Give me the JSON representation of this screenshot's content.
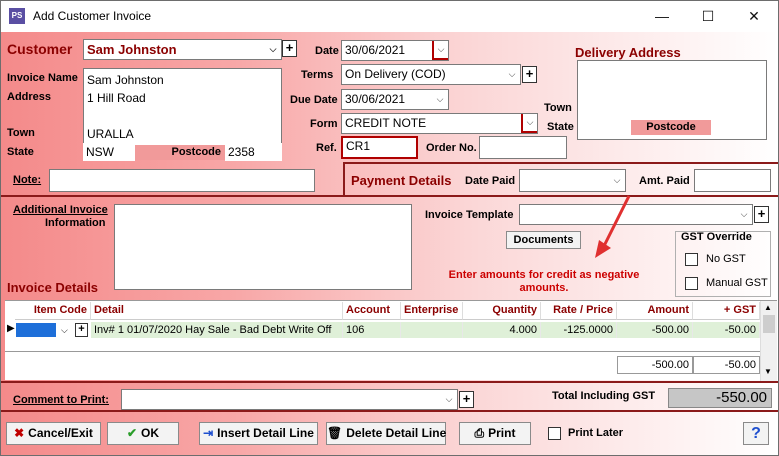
{
  "window": {
    "title": "Add Customer Invoice",
    "app_icon_text": "PS"
  },
  "customer": {
    "label": "Customer",
    "value": "Sam Johnston",
    "invoice_name_label": "Invoice Name",
    "address_label": "Address",
    "address_lines": [
      "Sam Johnston",
      "1 Hill Road",
      "",
      "URALLA"
    ],
    "town_label": "Town",
    "state_label": "State",
    "state_value": "NSW",
    "postcode_label": "Postcode",
    "postcode_value": "2358",
    "note_label": "Note:",
    "note_value": ""
  },
  "header": {
    "date_label": "Date",
    "date_value": "30/06/2021",
    "terms_label": "Terms",
    "terms_value": "On Delivery (COD)",
    "due_date_label": "Due Date",
    "due_date_value": "30/06/2021",
    "form_label": "Form",
    "form_value": "CREDIT NOTE",
    "ref_label": "Ref.",
    "ref_value": "CR1",
    "order_no_label": "Order No.",
    "order_no_value": ""
  },
  "delivery": {
    "title": "Delivery Address",
    "town_label": "Town",
    "state_label": "State",
    "postcode_label": "Postcode"
  },
  "payment": {
    "title": "Payment Details",
    "date_paid_label": "Date Paid",
    "date_paid_value": "",
    "amt_paid_label": "Amt. Paid",
    "amt_paid_value": ""
  },
  "additional": {
    "label_line1": "Additional Invoice",
    "label_line2": "Information",
    "value": ""
  },
  "template": {
    "label": "Invoice Template",
    "value": "",
    "documents_button": "Documents",
    "hint": "Enter amounts for credit as negative amounts."
  },
  "gst_override": {
    "title": "GST Override",
    "no_gst": "No GST",
    "manual_gst": "Manual GST"
  },
  "invoice_details": {
    "title": "Invoice Details",
    "columns": [
      "Item Code",
      "Detail",
      "Account",
      "Enterprise",
      "Quantity",
      "Rate / Price",
      "Amount",
      "+ GST"
    ],
    "rows": [
      {
        "item_code": "",
        "detail": "Inv# 1 01/07/2020 Hay Sale - Bad Debt Write Off",
        "account": "106",
        "enterprise": "",
        "quantity": "4.000",
        "rate": "-125.0000",
        "amount": "-500.00",
        "gst": "-50.00"
      }
    ],
    "total_amount": "-500.00",
    "total_gst": "-50.00"
  },
  "footer": {
    "comment_label": "Comment to Print:",
    "comment_value": "",
    "total_label": "Total Including GST",
    "total_value": "-550.00",
    "cancel_button": "Cancel/Exit",
    "ok_button": "OK",
    "insert_button": "Insert Detail Line",
    "delete_button": "Delete Detail Line",
    "print_button": "Print",
    "print_later_label": "Print Later",
    "help_button": "?"
  },
  "colors": {
    "accent": "#8b0000",
    "hint": "#cc0000",
    "arrow": "#e03030"
  }
}
